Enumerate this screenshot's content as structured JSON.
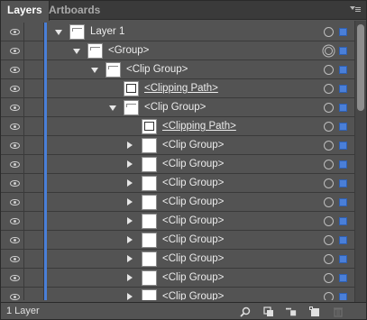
{
  "tabs": [
    {
      "label": "Layers",
      "active": true
    },
    {
      "label": "Artboards",
      "active": false
    }
  ],
  "accent_color": "#4a7fd8",
  "rows": [
    {
      "label": "Layer 1",
      "depth": 0,
      "twisty": "open",
      "thumb": "art",
      "underline": false,
      "target": "single"
    },
    {
      "label": "<Group>",
      "depth": 1,
      "twisty": "open",
      "thumb": "art",
      "underline": false,
      "target": "double"
    },
    {
      "label": "<Clip Group>",
      "depth": 2,
      "twisty": "open",
      "thumb": "art",
      "underline": false,
      "target": "single"
    },
    {
      "label": "<Clipping Path>",
      "depth": 3,
      "twisty": "none",
      "thumb": "box",
      "underline": true,
      "target": "single"
    },
    {
      "label": "<Clip Group>",
      "depth": 3,
      "twisty": "open",
      "thumb": "art",
      "underline": false,
      "target": "single"
    },
    {
      "label": "<Clipping Path>",
      "depth": 4,
      "twisty": "none",
      "thumb": "box",
      "underline": true,
      "target": "single"
    },
    {
      "label": "<Clip Group>",
      "depth": 4,
      "twisty": "closed",
      "thumb": "blank",
      "underline": false,
      "target": "single"
    },
    {
      "label": "<Clip Group>",
      "depth": 4,
      "twisty": "closed",
      "thumb": "blank",
      "underline": false,
      "target": "single"
    },
    {
      "label": "<Clip Group>",
      "depth": 4,
      "twisty": "closed",
      "thumb": "blank",
      "underline": false,
      "target": "single"
    },
    {
      "label": "<Clip Group>",
      "depth": 4,
      "twisty": "closed",
      "thumb": "blank",
      "underline": false,
      "target": "single"
    },
    {
      "label": "<Clip Group>",
      "depth": 4,
      "twisty": "closed",
      "thumb": "blank",
      "underline": false,
      "target": "single"
    },
    {
      "label": "<Clip Group>",
      "depth": 4,
      "twisty": "closed",
      "thumb": "blank",
      "underline": false,
      "target": "single"
    },
    {
      "label": "<Clip Group>",
      "depth": 4,
      "twisty": "closed",
      "thumb": "blank",
      "underline": false,
      "target": "single"
    },
    {
      "label": "<Clip Group>",
      "depth": 4,
      "twisty": "closed",
      "thumb": "blank",
      "underline": false,
      "target": "single"
    },
    {
      "label": "<Clip Group>",
      "depth": 4,
      "twisty": "closed",
      "thumb": "blank",
      "underline": false,
      "target": "single"
    }
  ],
  "footer": {
    "status": "1 Layer",
    "icons": [
      "locate-object-icon",
      "make-clipping-mask-icon",
      "new-sublayer-icon",
      "new-layer-icon",
      "delete-icon"
    ]
  }
}
